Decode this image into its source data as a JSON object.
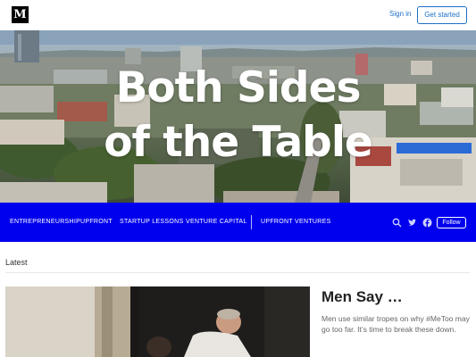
{
  "header": {
    "logo": "M",
    "signin_label": "Sign in",
    "get_started_label": "Get started"
  },
  "hero": {
    "title_line1": "Both Sides",
    "title_line2": "of the Table"
  },
  "nav": {
    "items": [
      "ENTREPRENEURSHIP",
      "UPFRONT",
      "STARTUP LESSONS",
      "VENTURE CAPITAL",
      "UPFRONT VENTURES"
    ],
    "follow_label": "Follow",
    "icons": [
      "search-icon",
      "twitter-icon",
      "facebook-icon"
    ]
  },
  "latest": {
    "heading": "Latest",
    "article": {
      "title": "Men Say …",
      "subtitle": "Men use similar tropes on why #MeToo may go too far. It’s time to break these down."
    }
  },
  "colors": {
    "accent": "#1e6fc8",
    "nav_bg": "#0000ee"
  }
}
